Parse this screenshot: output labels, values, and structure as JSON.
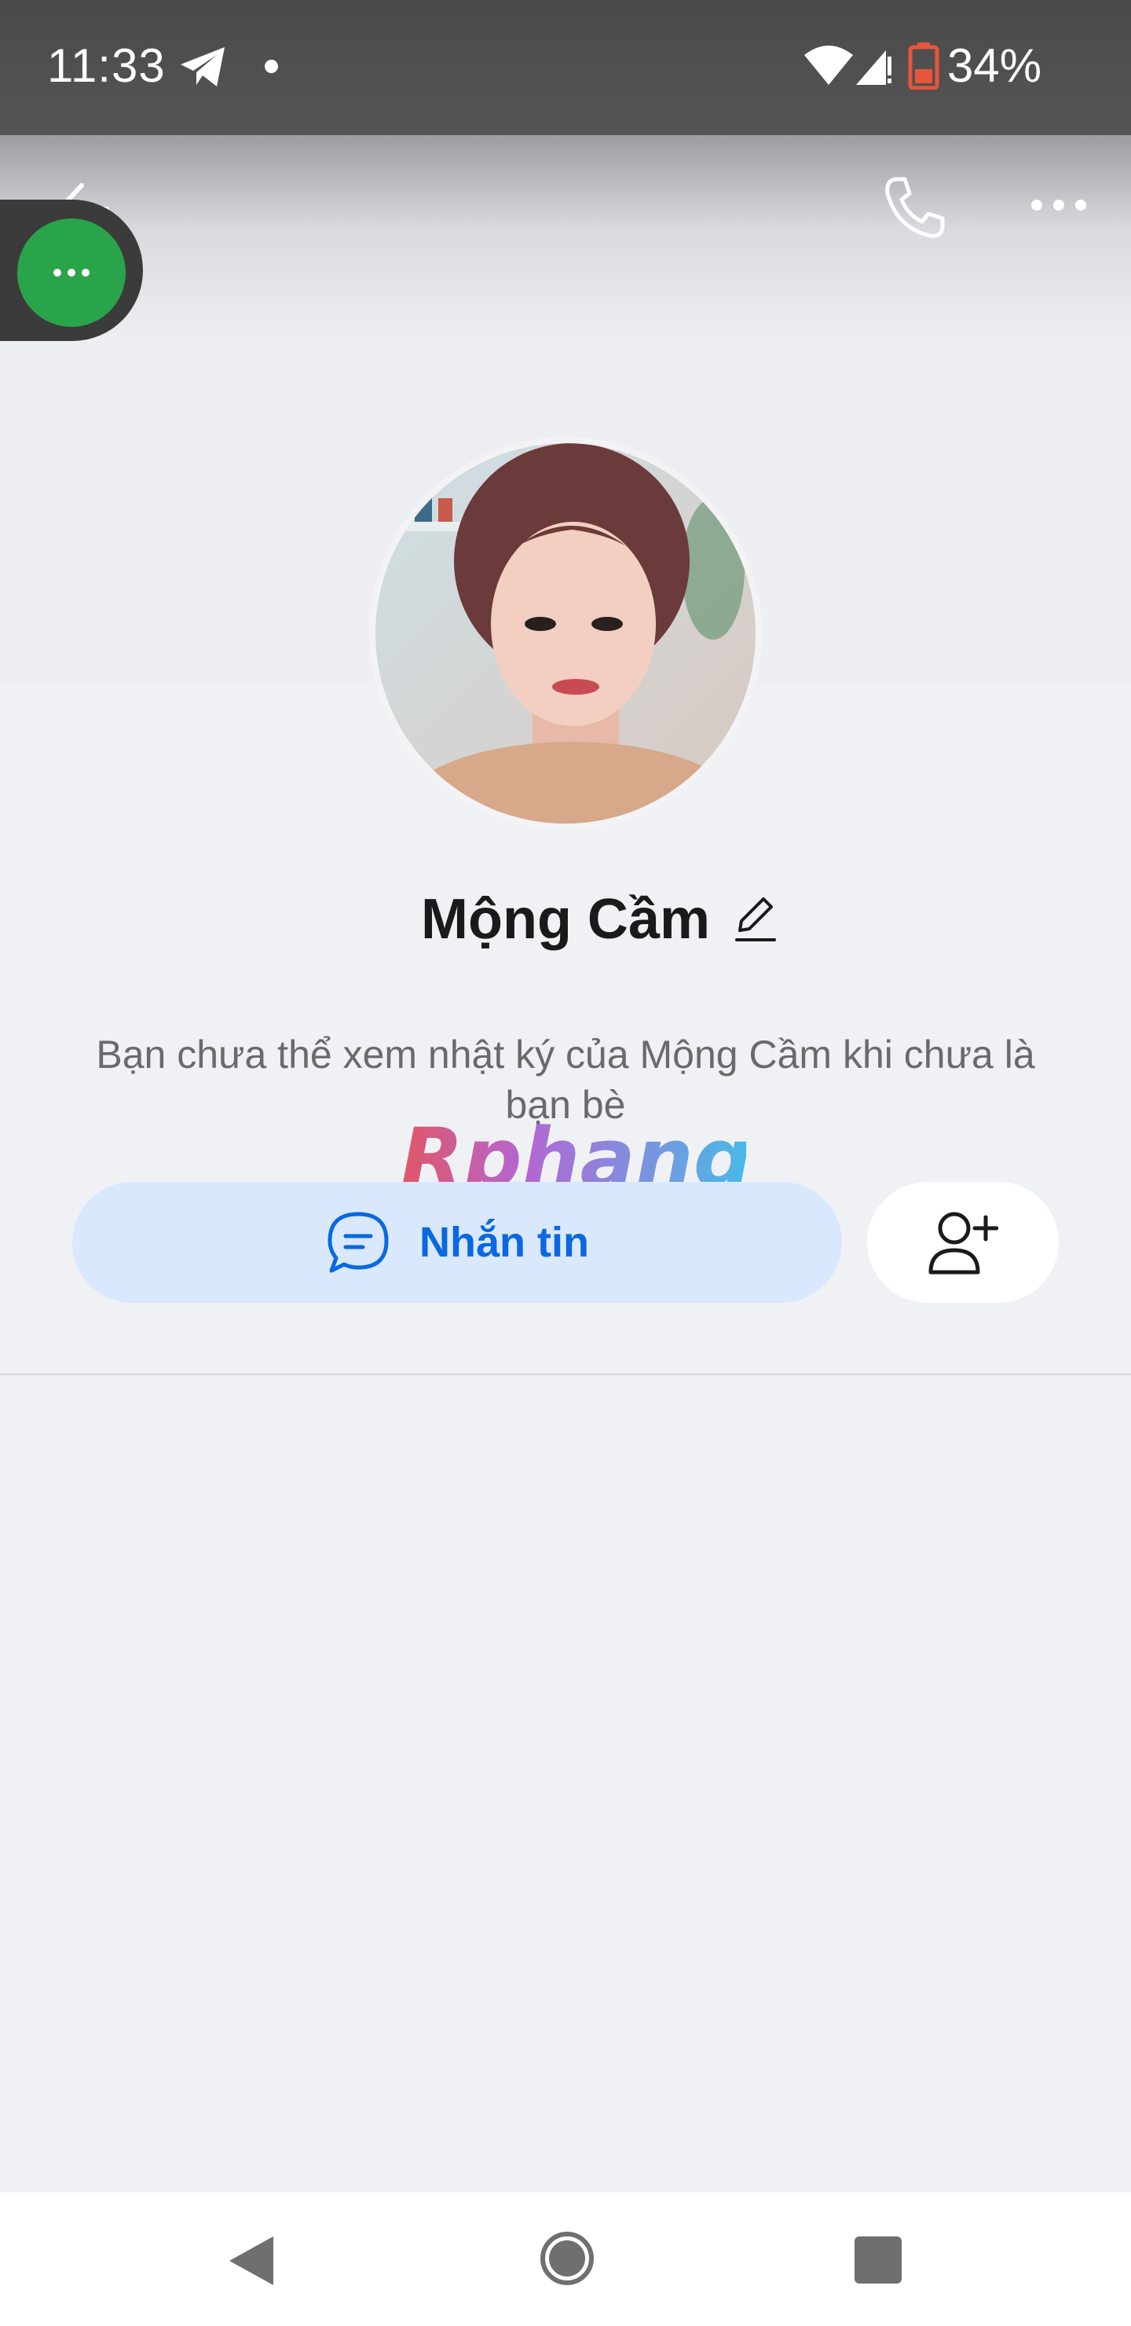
{
  "status_bar": {
    "time": "11:33",
    "battery_percent": "34%",
    "icons": [
      "telegram-icon",
      "notification-dot",
      "wifi-icon",
      "signal-icon",
      "battery-icon"
    ]
  },
  "header": {
    "icons": [
      "back-arrow-icon",
      "phone-call-icon",
      "more-options-icon"
    ]
  },
  "floating_bubble": {
    "icon": "more-dots-icon",
    "color": "#2aa44a"
  },
  "profile": {
    "name": "Mộng Cầm",
    "info_text": "Bạn chưa thể xem nhật ký của Mộng Cầm khi chưa là bạn bè"
  },
  "watermark": {
    "text": "Rphang"
  },
  "actions": {
    "message_label": "Nhắn tin",
    "message_color": "#0a68e0",
    "message_bg": "#d9e8fc",
    "add_friend_icon": "add-friend-icon"
  },
  "nav_bar": {
    "icons": [
      "nav-back-icon",
      "nav-home-icon",
      "nav-recents-icon"
    ]
  }
}
